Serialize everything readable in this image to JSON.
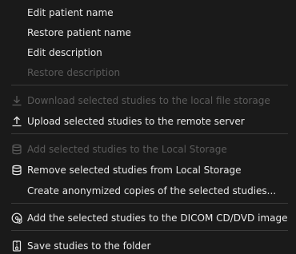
{
  "menu": {
    "items": [
      {
        "label": "Edit patient name"
      },
      {
        "label": "Restore patient name"
      },
      {
        "label": "Edit description"
      },
      {
        "label": "Restore description"
      },
      {
        "label": "Download selected studies to the local file storage",
        "icon": "download-icon"
      },
      {
        "label": "Upload selected studies to the remote server",
        "icon": "upload-icon"
      },
      {
        "label": "Add selected studies to the Local Storage",
        "icon": "database-icon"
      },
      {
        "label": "Remove selected studies from Local Storage",
        "icon": "database-icon"
      },
      {
        "label": "Create anonymized copies of the selected studies..."
      },
      {
        "label": "Add the selected studies to the DICOM CD/DVD image",
        "icon": "disc-icon"
      },
      {
        "label": "Save studies to the folder",
        "icon": "archive-icon"
      }
    ]
  },
  "colors": {
    "background": "#1a1a1a",
    "text": "#e8e8e8",
    "disabled_text": "#5b5b5b",
    "separator": "#3a3a3a"
  }
}
